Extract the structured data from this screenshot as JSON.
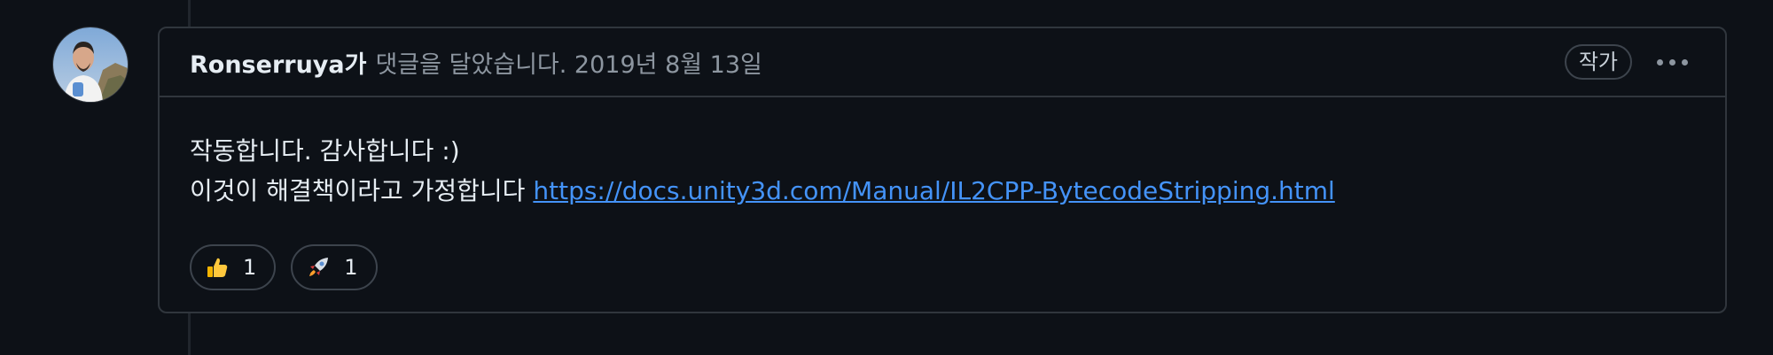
{
  "comment": {
    "author": "Ronserruya가",
    "meta": "댓글을 달았습니다. 2019년 8월 13일",
    "author_badge": "작가",
    "body_line1": "작동합니다. 감사합니다 :)",
    "body_line2_prefix": "이것이 해결책이라고 가정합니다",
    "link_text": "https://docs.unity3d.com/Manual/IL2CPP-BytecodeStripping.html",
    "reactions": [
      {
        "icon": "thumbs-up-icon",
        "count": "1"
      },
      {
        "icon": "rocket-icon",
        "count": "1"
      }
    ]
  },
  "colors": {
    "background": "#0d1117",
    "border": "#30363d",
    "link": "#4493f8",
    "muted_text": "#8d96a0"
  }
}
